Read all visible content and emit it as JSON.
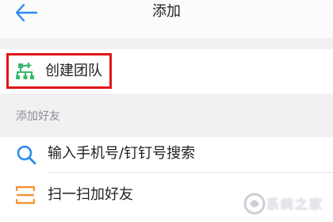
{
  "header": {
    "title": "添加",
    "back_icon": "arrow-left-icon"
  },
  "create_team": {
    "label": "创建团队",
    "icon": "org-chart-plus-icon",
    "icon_color": "#3bb86b",
    "highlight_color": "#e0161b"
  },
  "section": {
    "add_friends_header": "添加好友"
  },
  "search_row": {
    "label": "输入手机号/钉钉号搜索",
    "icon": "search-icon",
    "icon_color": "#2b8cf0"
  },
  "scan_row": {
    "label": "扫一扫加好友",
    "icon": "scan-icon",
    "icon_color": "#f59331"
  },
  "accent_color": "#2b8cf0",
  "watermark": {
    "text": "系统之家",
    "logo": "system-home-logo"
  }
}
